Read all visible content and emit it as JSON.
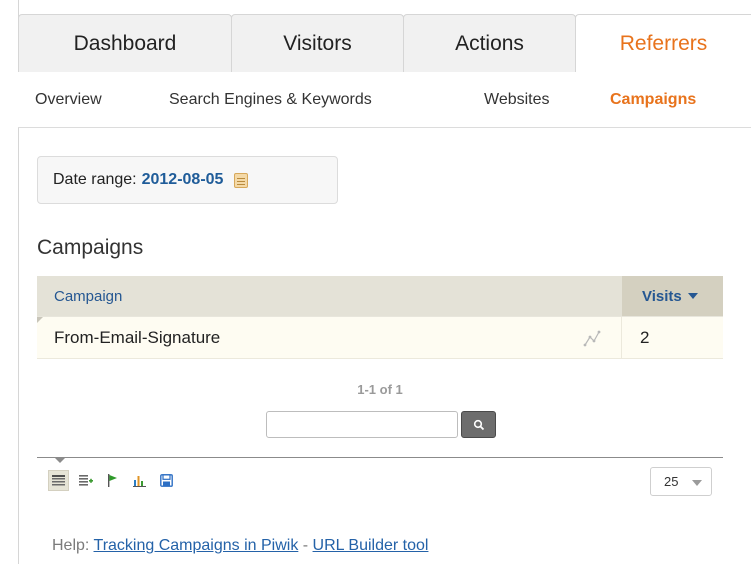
{
  "main_tabs": [
    {
      "label": "Dashboard"
    },
    {
      "label": "Visitors"
    },
    {
      "label": "Actions"
    },
    {
      "label": "Referrers",
      "active": true
    }
  ],
  "sub_tabs": [
    {
      "label": "Overview"
    },
    {
      "label": "Search Engines & Keywords"
    },
    {
      "label": "Websites"
    },
    {
      "label": "Campaigns",
      "active": true
    }
  ],
  "date_range": {
    "label": "Date range:",
    "value": "2012-08-05",
    "icon": "calendar-icon"
  },
  "section": {
    "title": "Campaigns"
  },
  "table": {
    "columns": [
      "Campaign",
      "Visits"
    ],
    "sorted_column": "Visits",
    "sort_direction": "desc",
    "rows": [
      {
        "campaign": "From-Email-Signature",
        "visits": "2"
      }
    ]
  },
  "pagination": {
    "text": "1-1 of 1"
  },
  "search": {
    "value": "",
    "placeholder": ""
  },
  "toolbar": {
    "icons": [
      "table-icon",
      "table-more-icon",
      "goals-flag-icon",
      "bar-chart-icon",
      "export-icon"
    ],
    "limit": "25"
  },
  "help": {
    "prefix": "Help:",
    "link1": "Tracking Campaigns in Piwik",
    "separator": " - ",
    "link2": "URL Builder tool"
  },
  "colors": {
    "accent_orange": "#e8731c",
    "link_blue": "#255792",
    "date_blue": "#1f5c99",
    "header_bg": "#e4e2d7",
    "row_bg": "#fefcf2"
  }
}
